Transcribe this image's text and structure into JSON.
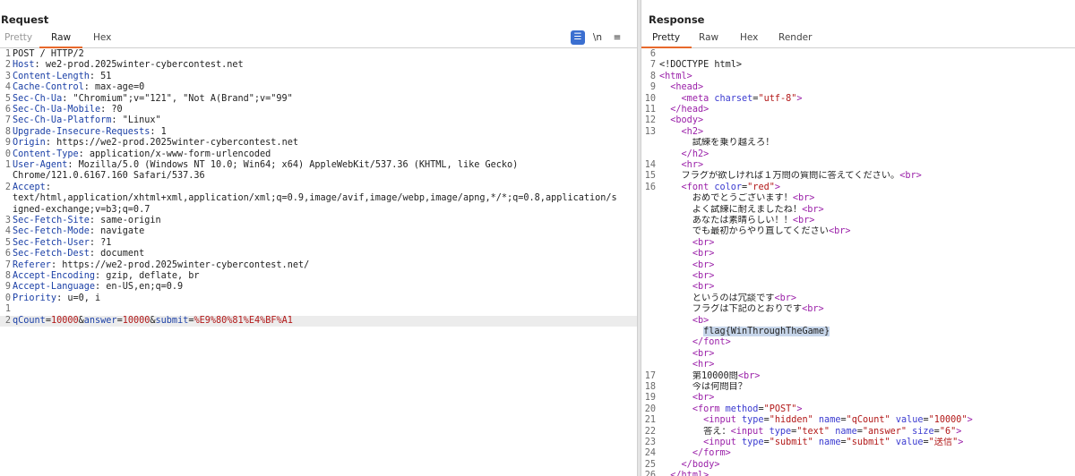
{
  "request": {
    "title": "Request",
    "tabs": [
      "Pretty",
      "Raw",
      "Hex"
    ],
    "active_tab": "Raw",
    "toolbar": {
      "wrap": "☰",
      "newline": "\\n",
      "menu": "≡"
    },
    "lines": [
      {
        "n": "1",
        "t": "plain",
        "text": "POST / HTTP/2"
      },
      {
        "n": "2",
        "t": "header",
        "k": "Host",
        "v": "we2-prod.2025winter-cybercontest.net"
      },
      {
        "n": "3",
        "t": "header",
        "k": "Content-Length",
        "v": "51"
      },
      {
        "n": "4",
        "t": "header",
        "k": "Cache-Control",
        "v": "max-age=0"
      },
      {
        "n": "5",
        "t": "header",
        "k": "Sec-Ch-Ua",
        "v": "\"Chromium\";v=\"121\", \"Not A(Brand\";v=\"99\""
      },
      {
        "n": "6",
        "t": "header",
        "k": "Sec-Ch-Ua-Mobile",
        "v": "?0"
      },
      {
        "n": "7",
        "t": "header",
        "k": "Sec-Ch-Ua-Platform",
        "v": "\"Linux\""
      },
      {
        "n": "8",
        "t": "header",
        "k": "Upgrade-Insecure-Requests",
        "v": "1"
      },
      {
        "n": "9",
        "t": "header",
        "k": "Origin",
        "v": "https://we2-prod.2025winter-cybercontest.net"
      },
      {
        "n": "0",
        "t": "header",
        "k": "Content-Type",
        "v": "application/x-www-form-urlencoded"
      },
      {
        "n": "1",
        "t": "header",
        "k": "User-Agent",
        "v": "Mozilla/5.0 (Windows NT 10.0; Win64; x64) AppleWebKit/537.36 (KHTML, like Gecko)"
      },
      {
        "n": "",
        "t": "plain",
        "text": "Chrome/121.0.6167.160 Safari/537.36"
      },
      {
        "n": "2",
        "t": "header",
        "k": "Accept",
        "v": ""
      },
      {
        "n": "",
        "t": "plain",
        "text": "text/html,application/xhtml+xml,application/xml;q=0.9,image/avif,image/webp,image/apng,*/*;q=0.8,application/s"
      },
      {
        "n": "",
        "t": "plain",
        "text": "igned-exchange;v=b3;q=0.7"
      },
      {
        "n": "3",
        "t": "header",
        "k": "Sec-Fetch-Site",
        "v": "same-origin"
      },
      {
        "n": "4",
        "t": "header",
        "k": "Sec-Fetch-Mode",
        "v": "navigate"
      },
      {
        "n": "5",
        "t": "header",
        "k": "Sec-Fetch-User",
        "v": "?1"
      },
      {
        "n": "6",
        "t": "header",
        "k": "Sec-Fetch-Dest",
        "v": "document"
      },
      {
        "n": "7",
        "t": "header",
        "k": "Referer",
        "v": "https://we2-prod.2025winter-cybercontest.net/"
      },
      {
        "n": "8",
        "t": "header",
        "k": "Accept-Encoding",
        "v": "gzip, deflate, br"
      },
      {
        "n": "9",
        "t": "header",
        "k": "Accept-Language",
        "v": "en-US,en;q=0.9"
      },
      {
        "n": "0",
        "t": "header",
        "k": "Priority",
        "v": "u=0, i"
      },
      {
        "n": "1",
        "t": "plain",
        "text": ""
      },
      {
        "n": "2",
        "t": "params",
        "hl": true,
        "parts": [
          {
            "c": "pk",
            "s": "qCount"
          },
          {
            "c": "",
            "s": "="
          },
          {
            "c": "pv",
            "s": "10000"
          },
          {
            "c": "",
            "s": "&"
          },
          {
            "c": "pk",
            "s": "answer"
          },
          {
            "c": "",
            "s": "="
          },
          {
            "c": "pv",
            "s": "10000"
          },
          {
            "c": "",
            "s": "&"
          },
          {
            "c": "pk",
            "s": "submit"
          },
          {
            "c": "",
            "s": "="
          },
          {
            "c": "pv",
            "s": "%E9%80%81%E4%BF%A1"
          }
        ]
      }
    ]
  },
  "response": {
    "title": "Response",
    "tabs": [
      "Pretty",
      "Raw",
      "Hex",
      "Render"
    ],
    "active_tab": "Pretty",
    "lines": [
      {
        "n": "6",
        "parts": []
      },
      {
        "n": "7",
        "parts": [
          {
            "c": "",
            "s": "<!DOCTYPE html>"
          }
        ]
      },
      {
        "n": "8",
        "parts": [
          {
            "c": "tag",
            "s": "<html>"
          }
        ]
      },
      {
        "n": "9",
        "parts": [
          {
            "c": "",
            "s": "  "
          },
          {
            "c": "tag",
            "s": "<head>"
          }
        ]
      },
      {
        "n": "10",
        "parts": [
          {
            "c": "",
            "s": "    "
          },
          {
            "c": "tag",
            "s": "<meta "
          },
          {
            "c": "an",
            "s": "charset"
          },
          {
            "c": "",
            "s": "="
          },
          {
            "c": "av",
            "s": "\"utf-8\""
          },
          {
            "c": "tag",
            "s": ">"
          }
        ]
      },
      {
        "n": "11",
        "parts": [
          {
            "c": "",
            "s": "  "
          },
          {
            "c": "tag",
            "s": "</head>"
          }
        ]
      },
      {
        "n": "12",
        "parts": [
          {
            "c": "",
            "s": "  "
          },
          {
            "c": "tag",
            "s": "<body>"
          }
        ]
      },
      {
        "n": "13",
        "parts": [
          {
            "c": "",
            "s": "    "
          },
          {
            "c": "tag",
            "s": "<h2>"
          }
        ]
      },
      {
        "n": "",
        "parts": [
          {
            "c": "",
            "s": "      試練を乗り越えろ！"
          }
        ]
      },
      {
        "n": "",
        "parts": [
          {
            "c": "",
            "s": "    "
          },
          {
            "c": "tag",
            "s": "</h2>"
          }
        ]
      },
      {
        "n": "14",
        "parts": [
          {
            "c": "",
            "s": "    "
          },
          {
            "c": "tag",
            "s": "<hr>"
          }
        ]
      },
      {
        "n": "15",
        "parts": [
          {
            "c": "",
            "s": "    フラグが欲しければ１万問の質問に答えてください。"
          },
          {
            "c": "tag",
            "s": "<br>"
          }
        ]
      },
      {
        "n": "16",
        "parts": [
          {
            "c": "",
            "s": "    "
          },
          {
            "c": "tag",
            "s": "<font "
          },
          {
            "c": "an",
            "s": "color"
          },
          {
            "c": "",
            "s": "="
          },
          {
            "c": "av",
            "s": "\"red\""
          },
          {
            "c": "tag",
            "s": ">"
          }
        ]
      },
      {
        "n": "",
        "parts": [
          {
            "c": "",
            "s": "      おめでとうございます！"
          },
          {
            "c": "tag",
            "s": "<br>"
          }
        ]
      },
      {
        "n": "",
        "parts": [
          {
            "c": "",
            "s": "      よく試練に耐えましたね！"
          },
          {
            "c": "tag",
            "s": "<br>"
          }
        ]
      },
      {
        "n": "",
        "parts": [
          {
            "c": "",
            "s": "      あなたは素晴らしい！！"
          },
          {
            "c": "tag",
            "s": "<br>"
          }
        ]
      },
      {
        "n": "",
        "parts": [
          {
            "c": "",
            "s": "      でも最初からやり直してください"
          },
          {
            "c": "tag",
            "s": "<br>"
          }
        ]
      },
      {
        "n": "",
        "parts": [
          {
            "c": "",
            "s": "      "
          },
          {
            "c": "tag",
            "s": "<br>"
          }
        ]
      },
      {
        "n": "",
        "parts": [
          {
            "c": "",
            "s": "      "
          },
          {
            "c": "tag",
            "s": "<br>"
          }
        ]
      },
      {
        "n": "",
        "parts": [
          {
            "c": "",
            "s": "      "
          },
          {
            "c": "tag",
            "s": "<br>"
          }
        ]
      },
      {
        "n": "",
        "parts": [
          {
            "c": "",
            "s": "      "
          },
          {
            "c": "tag",
            "s": "<br>"
          }
        ]
      },
      {
        "n": "",
        "parts": [
          {
            "c": "",
            "s": "      "
          },
          {
            "c": "tag",
            "s": "<br>"
          }
        ]
      },
      {
        "n": "",
        "parts": [
          {
            "c": "",
            "s": "      というのは冗談です"
          },
          {
            "c": "tag",
            "s": "<br>"
          }
        ]
      },
      {
        "n": "",
        "parts": [
          {
            "c": "",
            "s": "      フラグは下記のとおりです"
          },
          {
            "c": "tag",
            "s": "<br>"
          }
        ]
      },
      {
        "n": "",
        "parts": [
          {
            "c": "",
            "s": "      "
          },
          {
            "c": "tag",
            "s": "<b>"
          }
        ]
      },
      {
        "n": "",
        "parts": [
          {
            "c": "",
            "s": "        "
          },
          {
            "c": "sel",
            "s": "flag{WinThroughTheGame}"
          }
        ]
      },
      {
        "n": "",
        "parts": [
          {
            "c": "",
            "s": "      "
          },
          {
            "c": "tag",
            "s": "</font>"
          }
        ]
      },
      {
        "n": "",
        "parts": [
          {
            "c": "",
            "s": "      "
          },
          {
            "c": "tag",
            "s": "<br>"
          }
        ]
      },
      {
        "n": "",
        "parts": [
          {
            "c": "",
            "s": "      "
          },
          {
            "c": "tag",
            "s": "<hr>"
          }
        ]
      },
      {
        "n": "17",
        "parts": [
          {
            "c": "",
            "s": "      第10000問"
          },
          {
            "c": "tag",
            "s": "<br>"
          }
        ]
      },
      {
        "n": "18",
        "parts": [
          {
            "c": "",
            "s": "      今は何問目？"
          }
        ]
      },
      {
        "n": "19",
        "parts": [
          {
            "c": "",
            "s": "      "
          },
          {
            "c": "tag",
            "s": "<br>"
          }
        ]
      },
      {
        "n": "20",
        "parts": [
          {
            "c": "",
            "s": "      "
          },
          {
            "c": "tag",
            "s": "<form "
          },
          {
            "c": "an",
            "s": "method"
          },
          {
            "c": "",
            "s": "="
          },
          {
            "c": "av",
            "s": "\"POST\""
          },
          {
            "c": "tag",
            "s": ">"
          }
        ]
      },
      {
        "n": "21",
        "parts": [
          {
            "c": "",
            "s": "        "
          },
          {
            "c": "tag",
            "s": "<input "
          },
          {
            "c": "an",
            "s": "type"
          },
          {
            "c": "",
            "s": "="
          },
          {
            "c": "av",
            "s": "\"hidden\""
          },
          {
            "c": "",
            "s": " "
          },
          {
            "c": "an",
            "s": "name"
          },
          {
            "c": "",
            "s": "="
          },
          {
            "c": "av",
            "s": "\"qCount\""
          },
          {
            "c": "",
            "s": " "
          },
          {
            "c": "an",
            "s": "value"
          },
          {
            "c": "",
            "s": "="
          },
          {
            "c": "av",
            "s": "\"10000\""
          },
          {
            "c": "tag",
            "s": ">"
          }
        ]
      },
      {
        "n": "22",
        "parts": [
          {
            "c": "",
            "s": "        答え："
          },
          {
            "c": "tag",
            "s": "<input "
          },
          {
            "c": "an",
            "s": "type"
          },
          {
            "c": "",
            "s": "="
          },
          {
            "c": "av",
            "s": "\"text\""
          },
          {
            "c": "",
            "s": " "
          },
          {
            "c": "an",
            "s": "name"
          },
          {
            "c": "",
            "s": "="
          },
          {
            "c": "av",
            "s": "\"answer\""
          },
          {
            "c": "",
            "s": " "
          },
          {
            "c": "an",
            "s": "size"
          },
          {
            "c": "",
            "s": "="
          },
          {
            "c": "av",
            "s": "\"6\""
          },
          {
            "c": "tag",
            "s": ">"
          }
        ]
      },
      {
        "n": "23",
        "parts": [
          {
            "c": "",
            "s": "        "
          },
          {
            "c": "tag",
            "s": "<input "
          },
          {
            "c": "an",
            "s": "type"
          },
          {
            "c": "",
            "s": "="
          },
          {
            "c": "av",
            "s": "\"submit\""
          },
          {
            "c": "",
            "s": " "
          },
          {
            "c": "an",
            "s": "name"
          },
          {
            "c": "",
            "s": "="
          },
          {
            "c": "av",
            "s": "\"submit\""
          },
          {
            "c": "",
            "s": " "
          },
          {
            "c": "an",
            "s": "value"
          },
          {
            "c": "",
            "s": "="
          },
          {
            "c": "av",
            "s": "\"送信\""
          },
          {
            "c": "tag",
            "s": ">"
          }
        ]
      },
      {
        "n": "24",
        "parts": [
          {
            "c": "",
            "s": "      "
          },
          {
            "c": "tag",
            "s": "</form>"
          }
        ]
      },
      {
        "n": "25",
        "parts": [
          {
            "c": "",
            "s": "    "
          },
          {
            "c": "tag",
            "s": "</body>"
          }
        ]
      },
      {
        "n": "26",
        "parts": [
          {
            "c": "",
            "s": "  "
          },
          {
            "c": "tag",
            "s": "</html>"
          }
        ]
      }
    ]
  },
  "colors": {
    "accent_tab_underline": "#e8692c",
    "header_key": "#1a3fa6",
    "tag": "#9a1fa8",
    "attr_name": "#3a3ad0",
    "attr_value": "#b21818",
    "selection": "#c7d6ea",
    "wrap_button": "#3b6fd0"
  }
}
